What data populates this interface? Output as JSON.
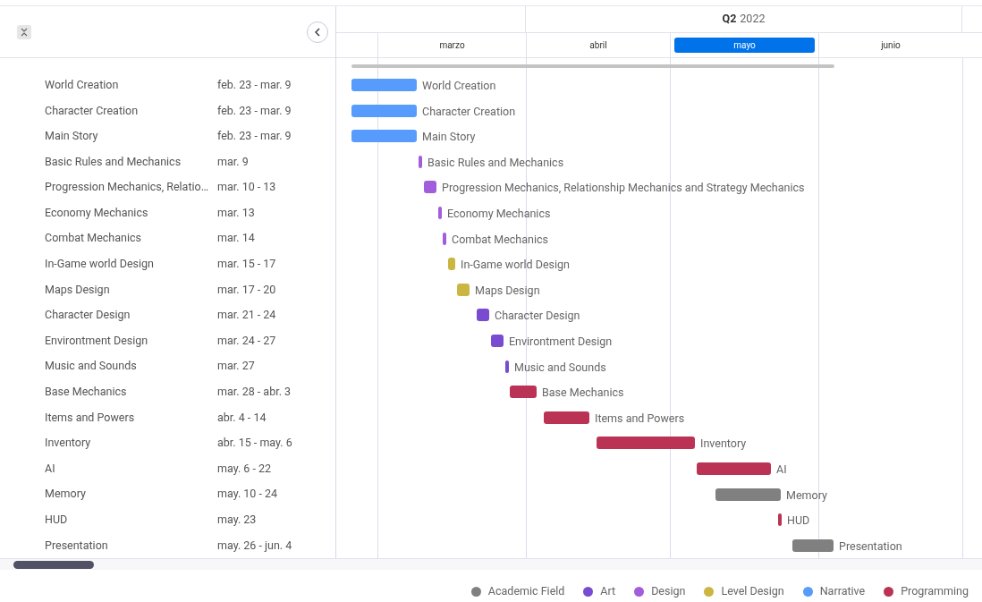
{
  "timeline": {
    "quarter": "Q2",
    "year": "2022",
    "months": [
      {
        "label": "marzo",
        "selected": false
      },
      {
        "label": "abril",
        "selected": false
      },
      {
        "label": "mayo",
        "selected": true
      },
      {
        "label": "junio",
        "selected": false
      }
    ]
  },
  "tasks": [
    {
      "name": "World Creation",
      "bar_label": "World Creation",
      "dates": "feb. 23 - mar. 9",
      "color": "#579bfc"
    },
    {
      "name": "Character Creation",
      "bar_label": "Character Creation",
      "dates": "feb. 23 - mar. 9",
      "color": "#579bfc"
    },
    {
      "name": "Main Story",
      "bar_label": "Main Story",
      "dates": "feb. 23 - mar. 9",
      "color": "#579bfc"
    },
    {
      "name": "Basic Rules and Mechanics",
      "bar_label": "Basic Rules and Mechanics",
      "dates": "mar. 9",
      "color": "#a25ddc"
    },
    {
      "name": "Progression Mechanics, Relatio…",
      "bar_label": "Progression Mechanics, Relationship Mechanics and Strategy Mechanics",
      "dates": "mar. 10 - 13",
      "color": "#a25ddc"
    },
    {
      "name": "Economy Mechanics",
      "bar_label": "Economy Mechanics",
      "dates": "mar. 13",
      "color": "#a25ddc"
    },
    {
      "name": "Combat Mechanics",
      "bar_label": "Combat Mechanics",
      "dates": "mar. 14",
      "color": "#a25ddc"
    },
    {
      "name": "In-Game world Design",
      "bar_label": "In-Game world Design",
      "dates": "mar. 15 - 17",
      "color": "#cab641"
    },
    {
      "name": "Maps Design",
      "bar_label": "Maps Design",
      "dates": "mar. 17 - 20",
      "color": "#cab641"
    },
    {
      "name": "Character Design",
      "bar_label": "Character Design",
      "dates": "mar. 21 - 24",
      "color": "#784bd1"
    },
    {
      "name": "Environtment Design",
      "bar_label": "Environtment Design",
      "dates": "mar. 24 - 27",
      "color": "#784bd1"
    },
    {
      "name": "Music and Sounds",
      "bar_label": "Music and Sounds",
      "dates": "mar. 27",
      "color": "#784bd1"
    },
    {
      "name": "Base Mechanics",
      "bar_label": "Base Mechanics",
      "dates": "mar. 28 - abr. 3",
      "color": "#bb3354"
    },
    {
      "name": "Items and Powers",
      "bar_label": "Items and Powers",
      "dates": "abr. 4 - 14",
      "color": "#bb3354"
    },
    {
      "name": "Inventory",
      "bar_label": "Inventory",
      "dates": "abr. 15 - may. 6",
      "color": "#bb3354"
    },
    {
      "name": "AI",
      "bar_label": "AI",
      "dates": "may. 6 - 22",
      "color": "#bb3354"
    },
    {
      "name": "Memory",
      "bar_label": "Memory",
      "dates": "may. 10 - 24",
      "color": "#808080"
    },
    {
      "name": "HUD",
      "bar_label": "HUD",
      "dates": "may. 23",
      "color": "#bb3354"
    },
    {
      "name": "Presentation",
      "bar_label": "Presentation",
      "dates": "may. 26 - jun. 4",
      "color": "#808080"
    }
  ],
  "legend": [
    {
      "label": "Academic Field",
      "color": "#808080"
    },
    {
      "label": "Art",
      "color": "#784bd1"
    },
    {
      "label": "Design",
      "color": "#a25ddc"
    },
    {
      "label": "Level Design",
      "color": "#cab641"
    },
    {
      "label": "Narrative",
      "color": "#579bfc"
    },
    {
      "label": "Programming",
      "color": "#bb3354"
    }
  ]
}
